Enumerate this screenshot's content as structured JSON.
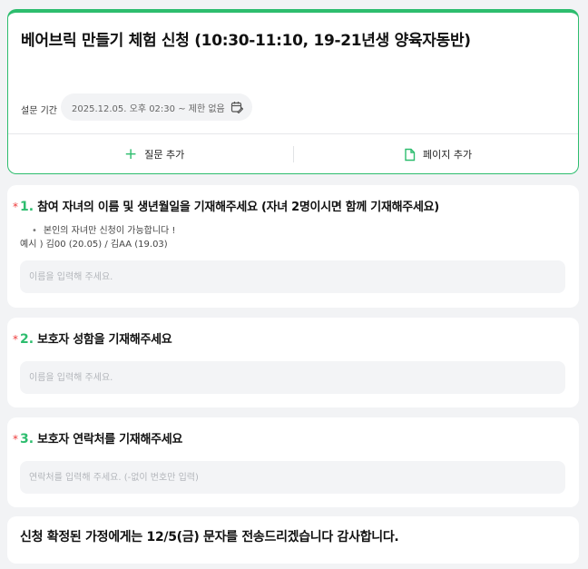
{
  "form": {
    "title": "베어브릭 만들기 체험 신청 (10:30-11:10, 19-21년생 양육자동반)",
    "period_label": "설문 기간",
    "period_value": "2025.12.05. 오후 02:30 ~ 제한 없음",
    "period_icon": "calendar-edit-icon",
    "add_question_label": "질문 추가",
    "add_question_icon": "plus-icon",
    "add_page_label": "페이지 추가",
    "add_page_icon": "page-icon",
    "accent_color": "#2dbd6e"
  },
  "questions": [
    {
      "required_mark": "*",
      "number": "1.",
      "title": "참여 자녀의 이름 및 생년월일을 기재해주세요 (자녀 2명이시면 함께 기재해주세요)",
      "bullet": "본인의 자녀만 신청이 가능합니다 !",
      "example": "예시 ) 김00 (20.05) / 김AA (19.03)",
      "placeholder": "이름을 입력해 주세요."
    },
    {
      "required_mark": "*",
      "number": "2.",
      "title": "보호자 성함을 기재해주세요",
      "placeholder": "이름을 입력해 주세요."
    },
    {
      "required_mark": "*",
      "number": "3.",
      "title": "보호자 연락처를 기재해주세요",
      "placeholder": "연락처를 입력해 주세요. (-없이 번호만 입력)"
    }
  ],
  "notice": {
    "text": "신청 확정된 가정에게는 12/5(금) 문자를 전송드리겠습니다 감사합니다."
  }
}
